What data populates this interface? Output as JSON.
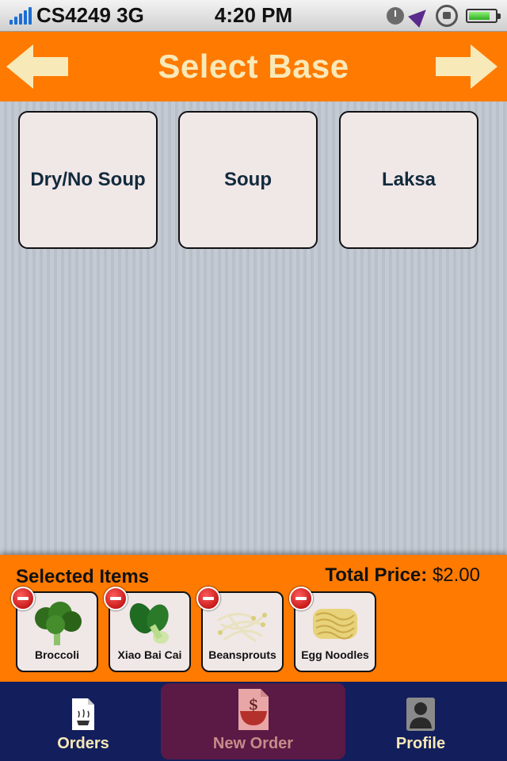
{
  "status_bar": {
    "carrier": "CS4249 3G",
    "time": "4:20 PM"
  },
  "header": {
    "title": "Select Base",
    "back_icon": "arrow-left-icon",
    "next_icon": "arrow-right-icon"
  },
  "bases": [
    {
      "label": "Dry/No Soup"
    },
    {
      "label": "Soup"
    },
    {
      "label": "Laksa"
    }
  ],
  "selected_panel": {
    "title": "Selected Items",
    "total_label": "Total Price:",
    "total_value": "$2.00",
    "items": [
      {
        "name": "Broccoli",
        "icon": "broccoli-icon"
      },
      {
        "name": "Xiao Bai Cai",
        "icon": "bok-choy-icon"
      },
      {
        "name": "Beansprouts",
        "icon": "beansprouts-icon"
      },
      {
        "name": "Egg Noodles",
        "icon": "egg-noodles-icon"
      }
    ]
  },
  "tabbar": {
    "tabs": [
      {
        "label": "Orders",
        "icon": "orders-icon"
      },
      {
        "label": "New Order",
        "icon": "new-order-icon",
        "selected": true
      },
      {
        "label": "Profile",
        "icon": "profile-icon"
      }
    ]
  },
  "colors": {
    "accent_orange": "#ff7a00",
    "title_cream": "#f8e9b8",
    "tabbar_navy": "#131f5c",
    "tab_selected": "#5a1a45"
  }
}
